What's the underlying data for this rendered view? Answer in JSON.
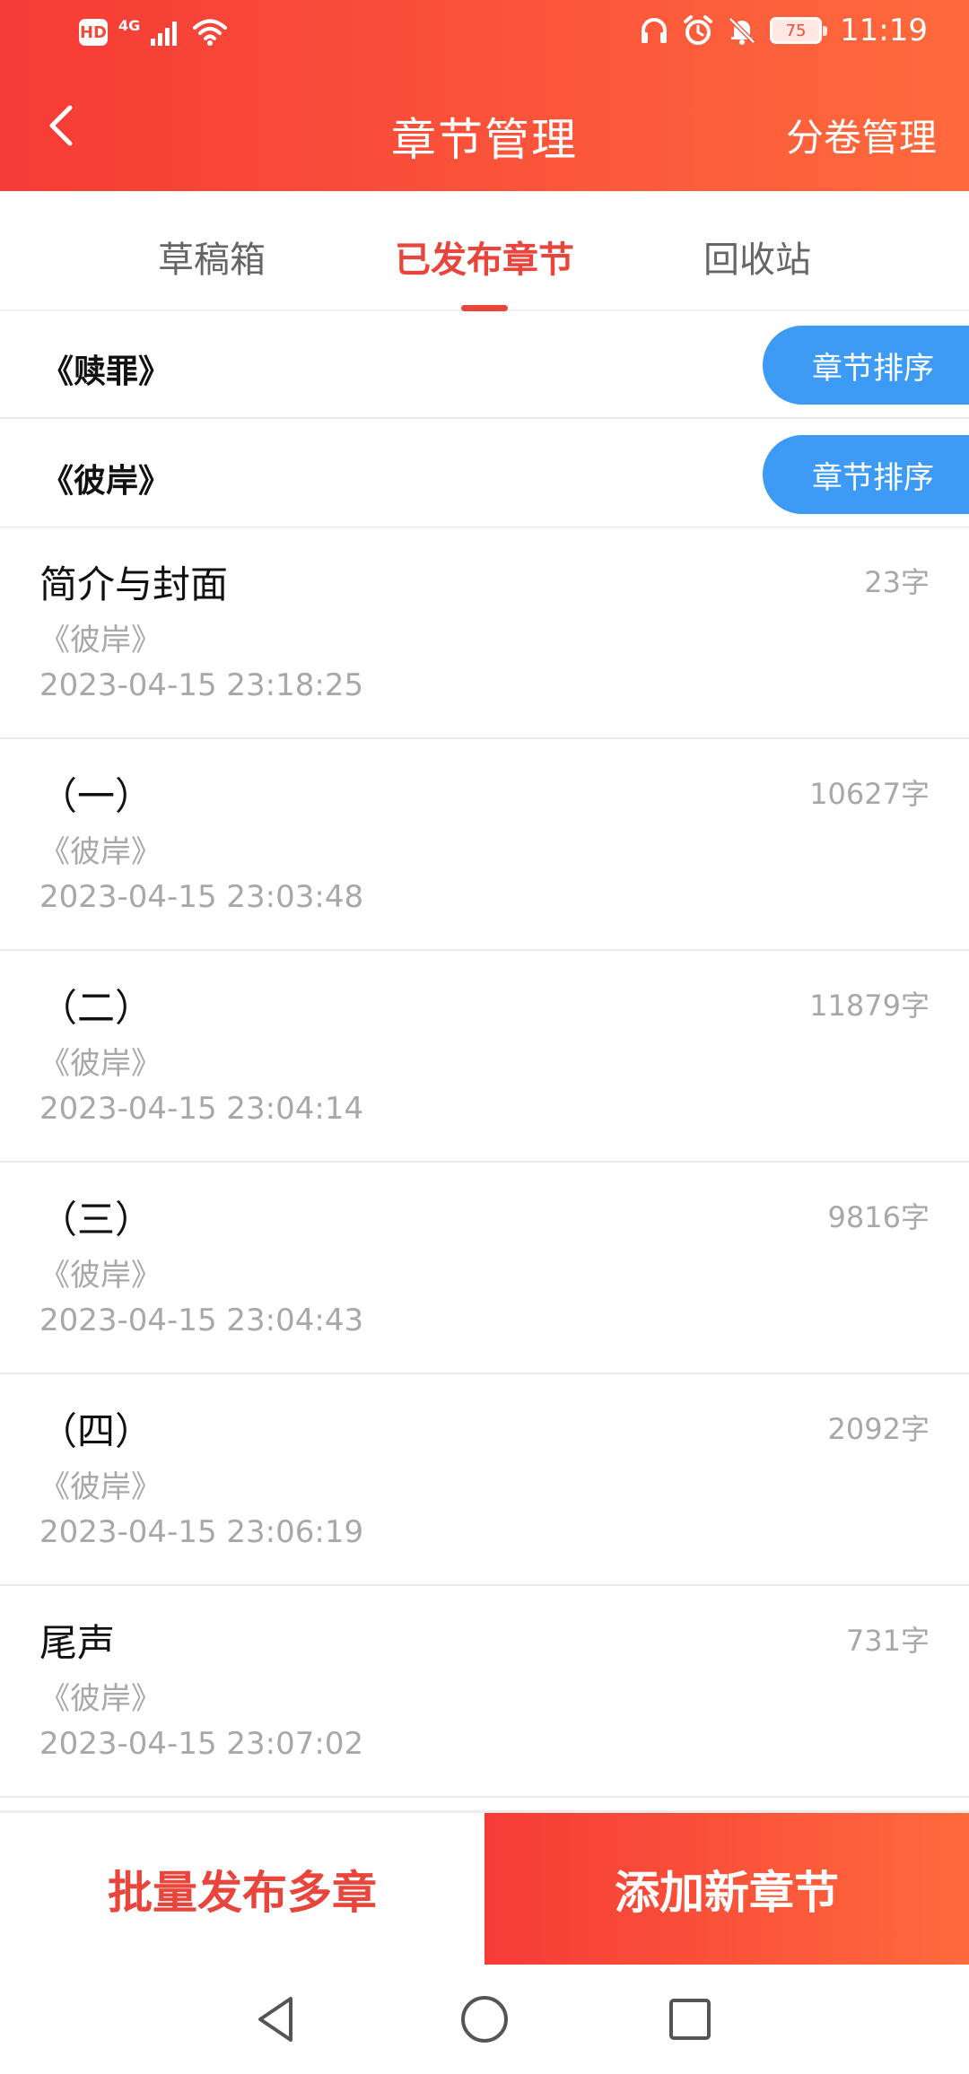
{
  "status_bar": {
    "network_label": "4G",
    "hd_label": "HD",
    "battery_level": "75",
    "time": "11:19"
  },
  "header": {
    "title": "章节管理",
    "right_action": "分卷管理"
  },
  "tabs": [
    {
      "label": "草稿箱",
      "active": false
    },
    {
      "label": "已发布章节",
      "active": true
    },
    {
      "label": "回收站",
      "active": false
    }
  ],
  "volumes": [
    {
      "name": "《赎罪》",
      "sort_label": "章节排序"
    },
    {
      "name": "《彼岸》",
      "sort_label": "章节排序"
    }
  ],
  "chapters": [
    {
      "title": "简介与封面",
      "count": "23字",
      "volume": "《彼岸》",
      "time": "2023-04-15 23:18:25"
    },
    {
      "title": "（一）",
      "count": "10627字",
      "volume": "《彼岸》",
      "time": "2023-04-15 23:03:48"
    },
    {
      "title": "（二）",
      "count": "11879字",
      "volume": "《彼岸》",
      "time": "2023-04-15 23:04:14"
    },
    {
      "title": "（三）",
      "count": "9816字",
      "volume": "《彼岸》",
      "time": "2023-04-15 23:04:43"
    },
    {
      "title": "（四）",
      "count": "2092字",
      "volume": "《彼岸》",
      "time": "2023-04-15 23:06:19"
    },
    {
      "title": "尾声",
      "count": "731字",
      "volume": "《彼岸》",
      "time": "2023-04-15 23:07:02"
    }
  ],
  "actions": {
    "batch_publish": "批量发布多章",
    "add_chapter": "添加新章节"
  },
  "colors": {
    "brand_red": "#f53b36",
    "brand_orange": "#ff6a3d",
    "sort_blue": "#3d9bf5",
    "muted_gray": "#a8a8a8"
  }
}
